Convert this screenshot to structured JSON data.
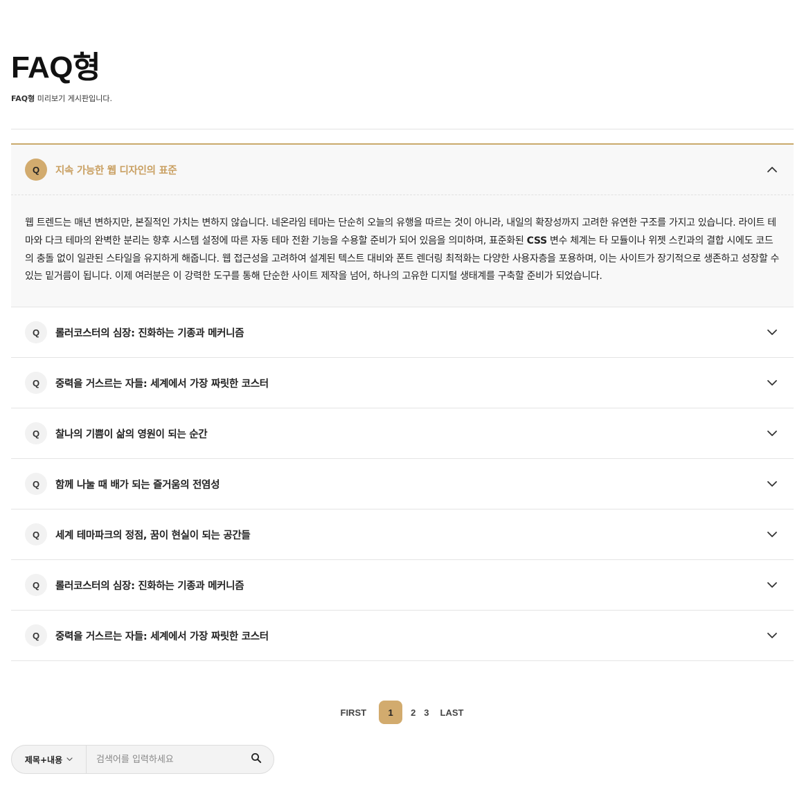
{
  "page": {
    "title": "FAQ형",
    "desc_bold": "FAQ형",
    "desc_rest": " 미리보기 게시판입니다."
  },
  "faq": {
    "badge": "Q",
    "open_item": {
      "question": "지속 가능한 웹 디자인의 표준",
      "answer_part1": "웹 트렌드는 매년 변하지만, 본질적인 가치는 변하지 않습니다. 네온라임 테마는 단순히 오늘의 유행을 따르는 것이 아니라, 내일의 확장성까지 고려한 유연한 구조를 가지고 있습니다. 라이트 테마와 다크 테마의 완벽한 분리는 향후 시스템 설정에 따른 자동 테마 전환 기능을 수용할 준비가 되어 있음을 의미하며, 표준화된 ",
      "answer_bold": "CSS",
      "answer_part2": " 변수 체계는 타 모듈이나 위젯 스킨과의 결합 시에도 코드의 충돌 없이 일관된 스타일을 유지하게 해줍니다. 웹 접근성을 고려하여 설계된 텍스트 대비와 폰트 렌더링 최적화는 다양한 사용자층을 포용하며, 이는 사이트가 장기적으로 생존하고 성장할 수 있는 밑거름이 됩니다. 이제 여러분은 이 강력한 도구를 통해 단순한 사이트 제작을 넘어, 하나의 고유한 디지털 생태계를 구축할 준비가 되었습니다."
    },
    "items": [
      {
        "question": "롤러코스터의 심장: 진화하는 기종과 메커니즘"
      },
      {
        "question": "중력을 거스르는 자들: 세계에서 가장 짜릿한 코스터"
      },
      {
        "question": "찰나의 기쁨이 삶의 영원이 되는 순간"
      },
      {
        "question": "함께 나눌 때 배가 되는 즐거움의 전염성"
      },
      {
        "question": "세계 테마파크의 정점, 꿈이 현실이 되는 공간들"
      },
      {
        "question": "롤러코스터의 심장: 진화하는 기종과 메커니즘"
      },
      {
        "question": "중력을 거스르는 자들: 세계에서 가장 짜릿한 코스터"
      }
    ]
  },
  "pagination": {
    "first": "FIRST",
    "pages": [
      "1",
      "2",
      "3"
    ],
    "current": "1",
    "last": "LAST"
  },
  "search": {
    "select_value": "제목+내용",
    "placeholder": "검색어를 입력하세요",
    "icon": "search-icon"
  },
  "colors": {
    "accent": "#d2ab6e",
    "accent_text": "#c9a062",
    "open_bg": "#f8f8f8"
  }
}
